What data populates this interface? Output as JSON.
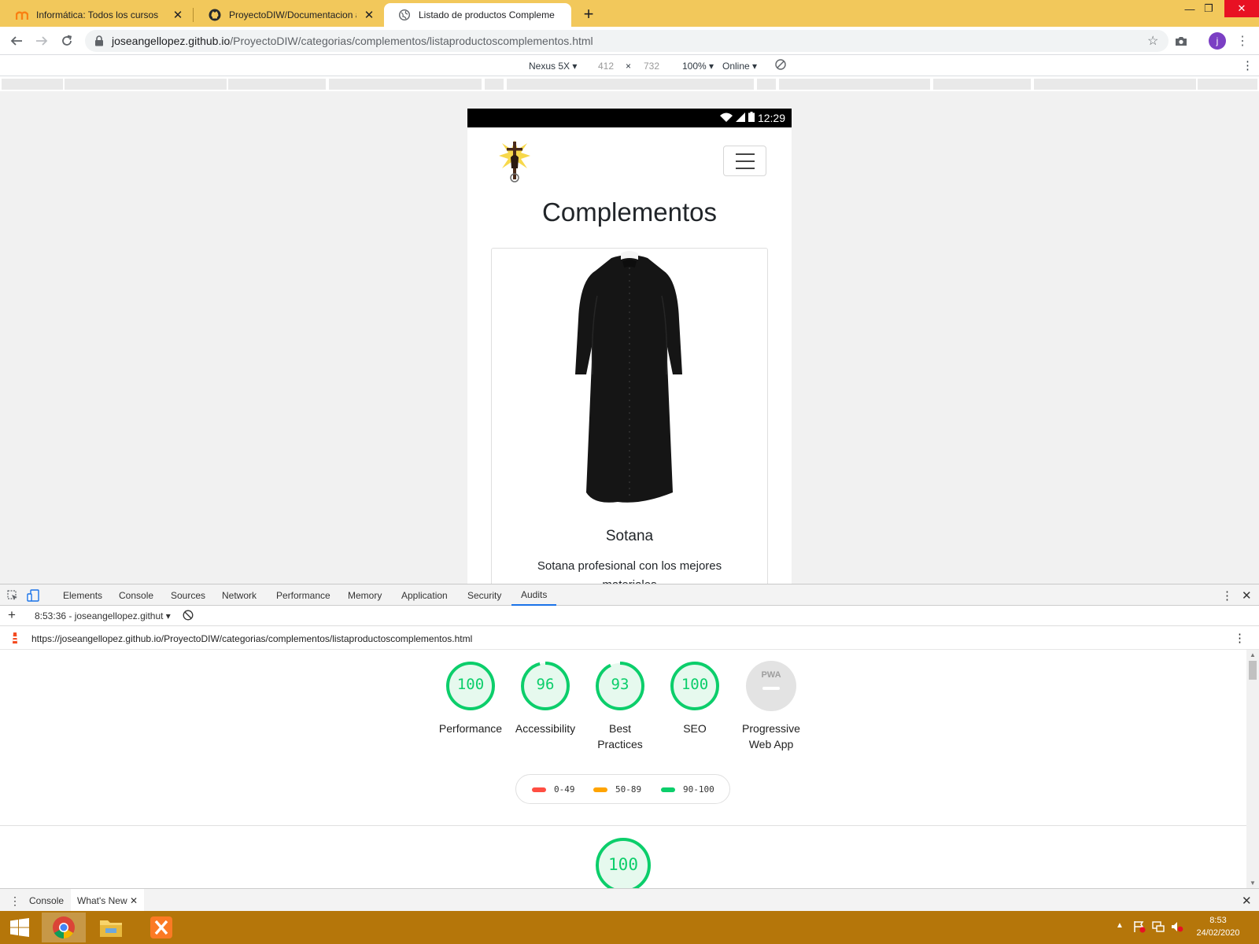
{
  "tabs": [
    {
      "title": "Informática: Todos los cursos",
      "active": false
    },
    {
      "title": "ProyectoDIW/Documentacion at",
      "active": false
    },
    {
      "title": "Listado de productos Compleme",
      "active": true
    }
  ],
  "address_bar": {
    "host": "joseangellopez.github.io",
    "path": "/ProyectoDIW/categorias/complementos/listaproductoscomplementos.html"
  },
  "profile_initial": "j",
  "device_toolbar": {
    "device": "Nexus 5X",
    "width": "412",
    "times": "×",
    "height": "732",
    "zoom": "100%",
    "network": "Online"
  },
  "phone": {
    "status_time": "12:29",
    "heading": "Complementos",
    "product": {
      "name": "Sotana",
      "description": "Sotana profesional con los mejores materiales"
    }
  },
  "devtools": {
    "tabs": [
      "Elements",
      "Console",
      "Sources",
      "Network",
      "Performance",
      "Memory",
      "Application",
      "Security",
      "Audits"
    ],
    "active_tab": "Audits",
    "report_selector": "8:53:36 - joseangellopez.githut",
    "audit_url": "https://joseangellopez.github.io/ProyectoDIW/categorias/complementos/listaproductoscomplementos.html",
    "gauges": [
      {
        "score": "100",
        "label": "Performance"
      },
      {
        "score": "96",
        "label": "Accessibility"
      },
      {
        "score": "93",
        "label": "Best Practices"
      },
      {
        "score": "100",
        "label": "SEO"
      },
      {
        "score": "",
        "label": "Progressive Web App",
        "badge": "PWA"
      }
    ],
    "gauge_values": [
      100,
      96,
      93,
      100
    ],
    "legend": [
      {
        "range": "0-49",
        "color": "#ff4e42"
      },
      {
        "range": "50-89",
        "color": "#ffa400"
      },
      {
        "range": "90-100",
        "color": "#0cce6b"
      }
    ],
    "section_score": "100",
    "drawer_tabs": [
      "Console",
      "What's New"
    ]
  },
  "taskbar": {
    "time": "8:53",
    "date": "24/02/2020"
  },
  "colors": {
    "tabstrip": "#f2c85b",
    "pass": "#0cce6b",
    "taskbar": "#b5760a"
  }
}
